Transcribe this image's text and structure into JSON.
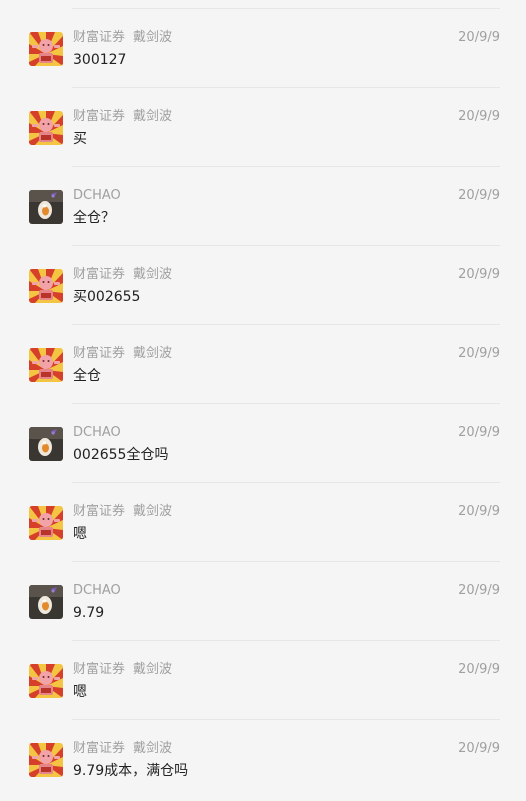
{
  "messages": [
    {
      "avatar": "sunburst-avatar",
      "sender": "财富证券",
      "sender_extra": "戴剑波",
      "time": "20/9/9",
      "text": "300127"
    },
    {
      "avatar": "sunburst-avatar",
      "sender": "财富证券",
      "sender_extra": "戴剑波",
      "time": "20/9/9",
      "text": "买"
    },
    {
      "avatar": "gem-avatar",
      "sender": "DCHAO",
      "sender_extra": "",
      "time": "20/9/9",
      "text": "全仓？"
    },
    {
      "avatar": "sunburst-avatar",
      "sender": "财富证券",
      "sender_extra": "戴剑波",
      "time": "20/9/9",
      "text": "买002655"
    },
    {
      "avatar": "sunburst-avatar",
      "sender": "财富证券",
      "sender_extra": "戴剑波",
      "time": "20/9/9",
      "text": "全仓"
    },
    {
      "avatar": "gem-avatar",
      "sender": "DCHAO",
      "sender_extra": "",
      "time": "20/9/9",
      "text": "002655全仓吗"
    },
    {
      "avatar": "sunburst-avatar",
      "sender": "财富证券",
      "sender_extra": "戴剑波",
      "time": "20/9/9",
      "text": "嗯"
    },
    {
      "avatar": "gem-avatar",
      "sender": "DCHAO",
      "sender_extra": "",
      "time": "20/9/9",
      "text": "9.79"
    },
    {
      "avatar": "sunburst-avatar",
      "sender": "财富证券",
      "sender_extra": "戴剑波",
      "time": "20/9/9",
      "text": "嗯"
    },
    {
      "avatar": "sunburst-avatar",
      "sender": "财富证券",
      "sender_extra": "戴剑波",
      "time": "20/9/9",
      "text": "9.79成本，满仓吗"
    }
  ]
}
